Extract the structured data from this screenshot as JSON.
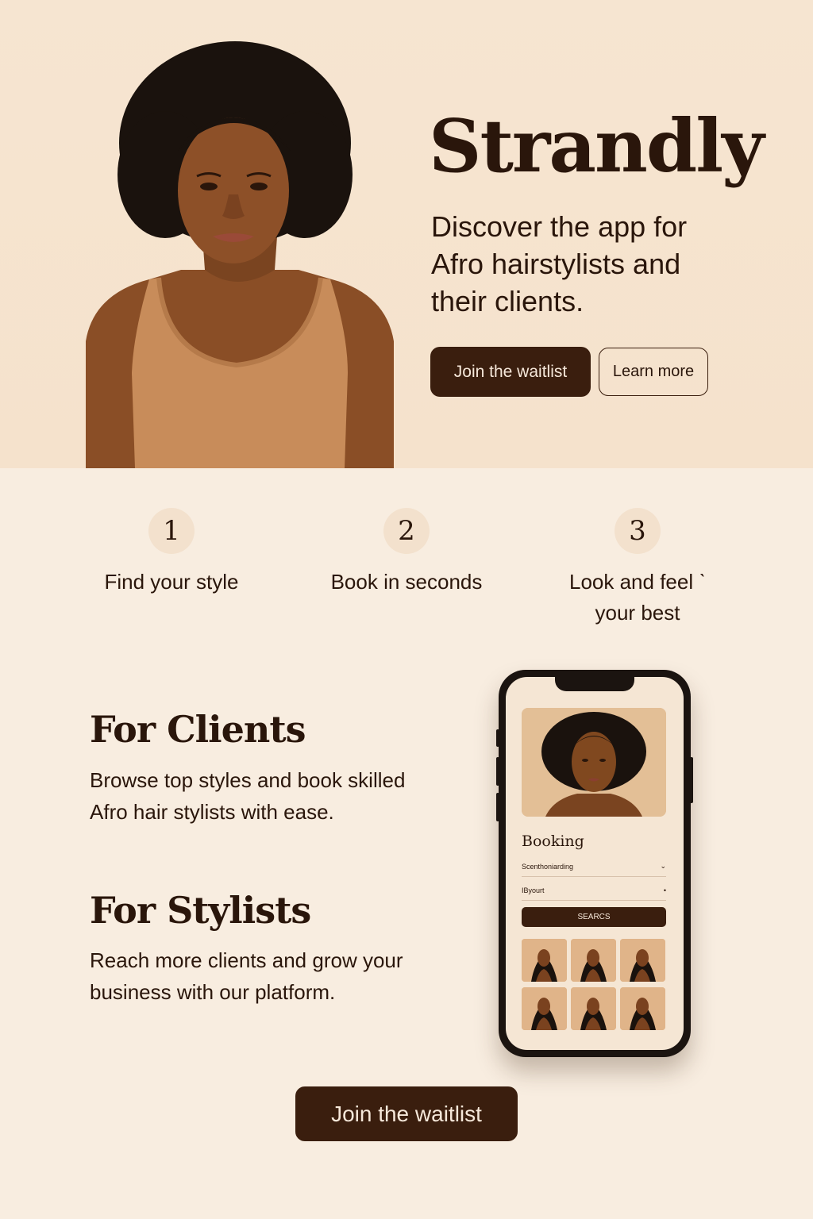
{
  "hero": {
    "brand": "Strandly",
    "tagline": "Discover the app for Afro hairstylists and their clients.",
    "primary_button": "Join the waitlist",
    "secondary_button": "Learn more"
  },
  "steps": [
    {
      "number": "1",
      "label": "Find your style"
    },
    {
      "number": "2",
      "label": "Book in seconds"
    },
    {
      "number": "3",
      "label": "Look and feel ˋ your best"
    }
  ],
  "clients": {
    "title": "For Clients",
    "text": "Browse top styles and book skilled Afro hair stylists with ease."
  },
  "stylists": {
    "title": "For Stylists",
    "text": "Reach more clients and grow your business with our platform."
  },
  "phone": {
    "booking_title": "Booking",
    "field1": "Scenthoniarding",
    "field1_icon": "chevron-down-icon",
    "field2": "IByourt",
    "field2_icon": "dot-icon",
    "search_button": "SEARCS"
  },
  "cta": {
    "label": "Join the waitlist"
  },
  "colors": {
    "background": "#f8ede0",
    "hero_background": "#f6e5d1",
    "primary_button": "#3a1e0e",
    "text": "#2a160b"
  }
}
